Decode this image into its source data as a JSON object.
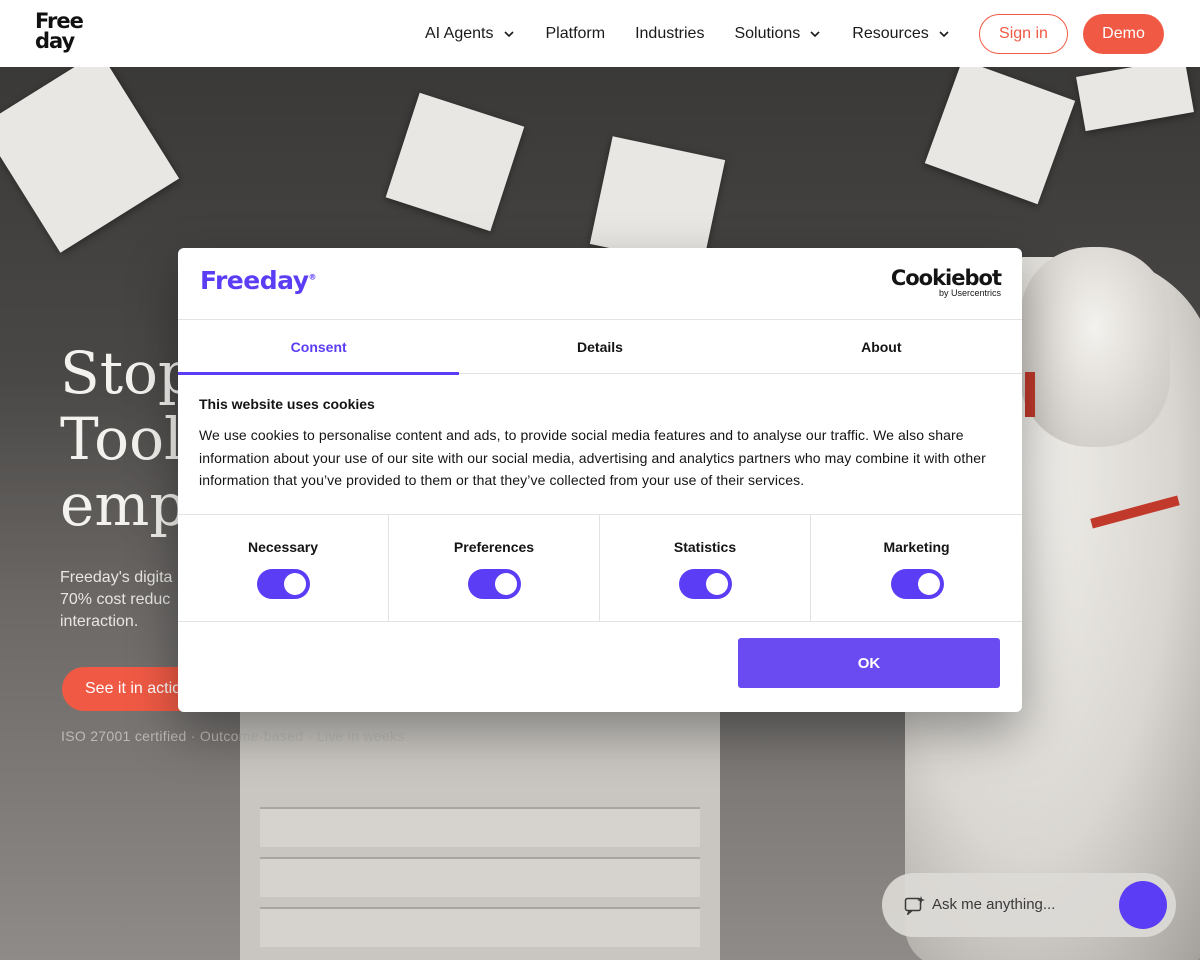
{
  "header": {
    "logo_line1": "Free",
    "logo_line2": "day",
    "nav": [
      {
        "label": "AI Agents",
        "has_dropdown": true
      },
      {
        "label": "Platform",
        "has_dropdown": false
      },
      {
        "label": "Industries",
        "has_dropdown": false
      },
      {
        "label": "Solutions",
        "has_dropdown": true
      },
      {
        "label": "Resources",
        "has_dropdown": true
      }
    ],
    "sign_in": "Sign in",
    "demo": "Demo"
  },
  "hero": {
    "title_lines": [
      "Stop",
      "Tools",
      "empl"
    ],
    "subtitle_lines": [
      "Freeday's digita",
      "70% cost reduc",
      "interaction."
    ],
    "cta": "See it in actio",
    "meta": "ISO 27001 certified · Outcome-based · Live in weeks"
  },
  "chat": {
    "placeholder": "Ask me anything..."
  },
  "cookie_dialog": {
    "brand": "Freeday",
    "provider": "Cookiebot",
    "provider_sub": "by Usercentrics",
    "tabs": [
      "Consent",
      "Details",
      "About"
    ],
    "active_tab": "Consent",
    "heading": "This website uses cookies",
    "body": "We use cookies to personalise content and ads, to provide social media features and to analyse our traffic. We also share information about your use of our site with our social media, advertising and analytics partners who may combine it with other information that you’ve provided to them or that they’ve collected from your use of their services.",
    "categories": [
      {
        "label": "Necessary",
        "enabled": true
      },
      {
        "label": "Preferences",
        "enabled": true
      },
      {
        "label": "Statistics",
        "enabled": true
      },
      {
        "label": "Marketing",
        "enabled": true
      }
    ],
    "ok_label": "OK"
  },
  "colors": {
    "accent": "#f05a45",
    "cookie_brand": "#5b3df5",
    "ok_button": "#6a4bf2"
  }
}
